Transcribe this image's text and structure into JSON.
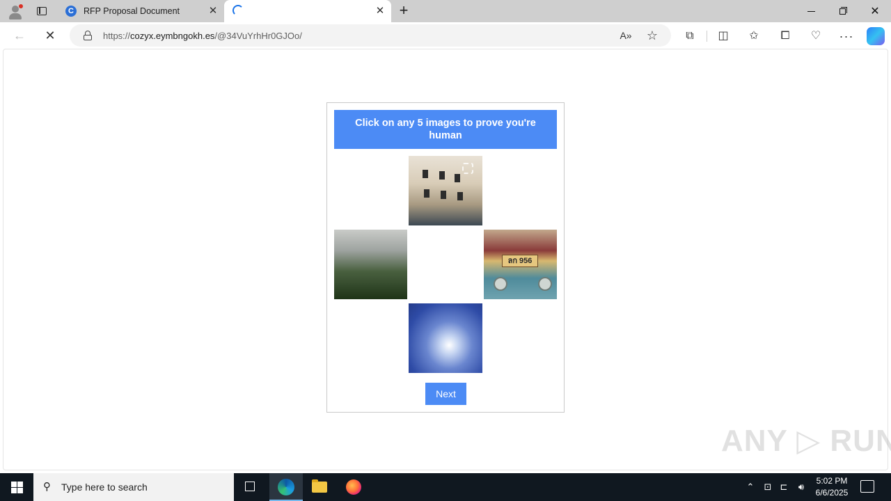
{
  "browser": {
    "tabs": [
      {
        "title": "RFP Proposal Document",
        "favicon_letter": "C",
        "close": "✕"
      },
      {
        "title": "",
        "close": "✕"
      }
    ],
    "new_tab": "+",
    "window": {
      "minimize": "",
      "close": "✕"
    },
    "nav": {
      "back": "←",
      "stop": "✕"
    },
    "address": {
      "scheme": "https://",
      "host": "cozyx.eymbngokh.es",
      "path": "/@34VuYrhHr0GJOo/"
    },
    "toolbar_icons": [
      "read-aloud-icon",
      "favorite-star-icon",
      "extensions-icon",
      "split-screen-icon",
      "favorites-icon",
      "collections-icon",
      "performance-icon",
      "more-icon",
      "copilot-icon"
    ],
    "read_aloud_glyph": "A»",
    "star_glyph": "☆",
    "ext_glyph": "⧉",
    "split_glyph": "◫",
    "favs_glyph": "✩",
    "collections_glyph": "⧠",
    "perf_glyph": "♡",
    "more_glyph": "···"
  },
  "captcha": {
    "instruction": "Click on any 5 images to prove you're human",
    "images": [
      {
        "name": "street-buildings"
      },
      {
        "name": "misty-forest"
      },
      {
        "name": "vintage-car"
      },
      {
        "name": "blue-smoke"
      }
    ],
    "plate_text": "ลก 956",
    "next_label": "Next",
    "accent": "#4c8bf5"
  },
  "watermark": "ANY ▷ RUN",
  "taskbar": {
    "search_placeholder": "Type here to search",
    "search_glyph": "⚲",
    "tray_up": "⌃",
    "tray_net": "⊡",
    "tray_wifi": "⊏",
    "tray_vol": "🔊︎",
    "time": "5:02 PM",
    "date": "6/6/2025"
  }
}
